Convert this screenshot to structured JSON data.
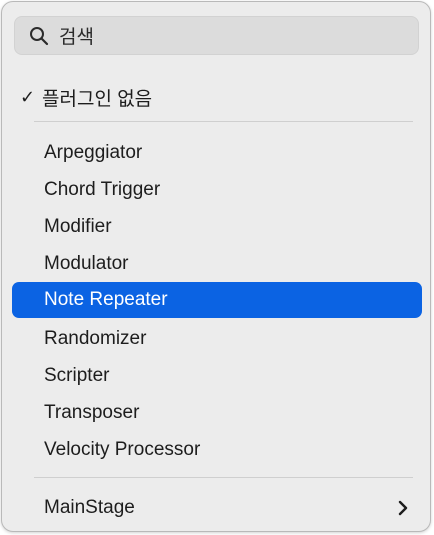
{
  "search": {
    "placeholder": "검색",
    "icon": "search-icon"
  },
  "no_plugin": {
    "check": "✓",
    "label": "플러그인 없음"
  },
  "plugins": [
    {
      "label": "Arpeggiator"
    },
    {
      "label": "Chord Trigger"
    },
    {
      "label": "Modifier"
    },
    {
      "label": "Modulator"
    },
    {
      "label": "Note Repeater",
      "selected": true
    },
    {
      "label": "Randomizer"
    },
    {
      "label": "Scripter"
    },
    {
      "label": "Transposer"
    },
    {
      "label": "Velocity Processor"
    }
  ],
  "submenu": {
    "label": "MainStage",
    "icon": "chevron-right-icon"
  },
  "colors": {
    "highlight": "#0b63e3",
    "menu_background": "#ececec",
    "text": "#1d1d1d"
  }
}
